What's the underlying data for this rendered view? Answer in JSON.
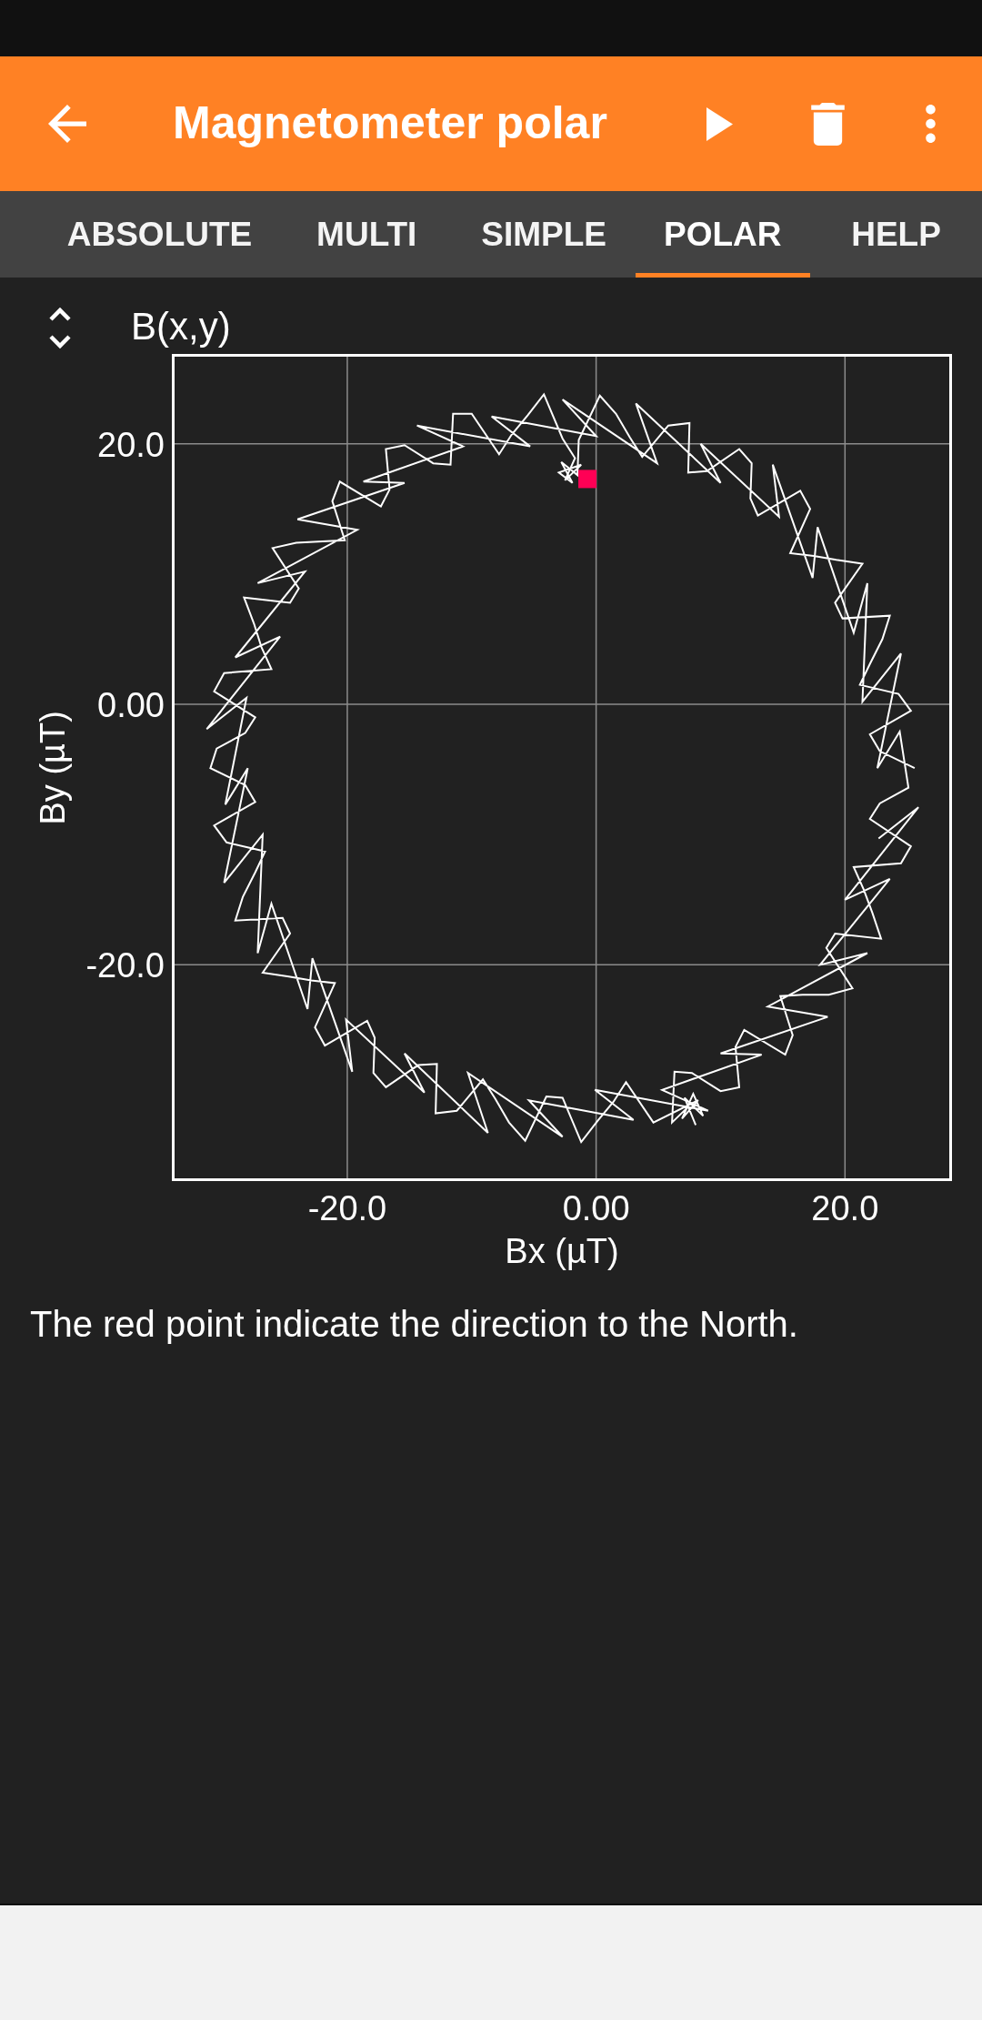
{
  "app_bar": {
    "title": "Magnetometer polar"
  },
  "tabs": [
    {
      "label": "ABSOLUTE",
      "selected": false
    },
    {
      "label": "MULTI",
      "selected": false
    },
    {
      "label": "SIMPLE",
      "selected": false
    },
    {
      "label": "POLAR",
      "selected": true
    },
    {
      "label": "HELP",
      "selected": false
    }
  ],
  "chart": {
    "chart_data": {
      "type": "line",
      "title": "B(x,y)",
      "xlabel": "Bx (µT)",
      "ylabel": "By (µT)",
      "grid": true,
      "x": [
        25.6,
        22.8,
        22.0,
        25.3,
        24.3,
        21.2,
        22.0,
        23.0,
        23.6,
        19.8,
        19.2,
        21.4,
        19.3,
        17.5,
        15.6,
        17.2,
        16.4,
        13.0,
        12.4,
        12.5,
        11.5,
        8.9,
        7.4,
        7.5,
        5.8,
        3.7,
        2.7,
        1.6,
        0.3,
        -1.4,
        -1.5,
        -2.8,
        -1.9,
        -3.0,
        -1.2,
        -2.5,
        -1.7,
        -2.7,
        -4.2,
        -5.5,
        -6.8,
        -7.8,
        -10.0,
        -11.5,
        -11.7,
        -13.1,
        -15.4,
        -16.9,
        -16.6,
        -17.3,
        -20.6,
        -21.2,
        -20.2,
        -22.0,
        -24.1,
        -26.0,
        -23.9,
        -24.6,
        -28.3,
        -27.5,
        -26.9,
        -26.1,
        -29.9,
        -30.7,
        -27.4,
        -28.2,
        -30.5,
        -31.0,
        -28.2,
        -27.4,
        -30.7,
        -29.7,
        -26.6,
        -27.4,
        -28.4,
        -29.0,
        -25.2,
        -24.6,
        -26.8,
        -24.7,
        -22.9,
        -21.0,
        -22.6,
        -21.8,
        -18.4,
        -17.8,
        -17.9,
        -16.9,
        -14.3,
        -12.8,
        -12.9,
        -11.2,
        -9.1,
        -8.1,
        -7.0,
        -5.7,
        -4.0,
        -2.7,
        -1.2,
        0.1,
        1.4,
        2.4,
        4.6,
        8.2,
        6.9,
        7.8,
        8.6,
        7.1,
        8.0,
        7.4,
        6.1,
        6.3,
        7.7,
        10.0,
        11.5,
        11.2,
        11.9,
        15.2,
        15.8,
        14.8,
        16.6,
        18.7,
        20.6,
        18.5,
        19.2,
        22.9,
        22.2,
        21.5,
        20.7,
        24.5,
        25.3,
        22.0,
        22.8,
        25.1,
        24.4,
        22.6,
        24.5,
        21.4,
        21.8,
        20.7,
        17.8,
        17.4,
        14.2,
        14.7,
        8.4,
        10.0,
        3.2,
        4.9,
        -2.7,
        0.0,
        -8.4,
        -5.3,
        -14.4,
        -10.7,
        -18.7,
        -15.4,
        -24.0,
        -19.2,
        -27.2,
        -23.4,
        -29.0,
        -25.4,
        -31.3,
        -28.1,
        -29.8,
        -28.0,
        -29.9,
        -26.8,
        -27.2,
        -26.1,
        -23.2,
        -22.8,
        -19.6,
        -20.1,
        -13.8,
        -15.4,
        -8.7,
        -10.3,
        -2.7,
        -5.4,
        3.0,
        -0.1,
        9.0,
        5.3,
        13.3,
        10.0,
        18.6,
        13.8,
        21.8,
        18.0,
        23.6,
        20.0,
        25.9,
        22.7,
        -0.7
      ],
      "series": [
        {
          "color": "#ffffff",
          "values": [
            -4.9,
            -3.6,
            -2.3,
            -0.5,
            0.8,
            1.5,
            3.1,
            5.0,
            6.8,
            6.6,
            7.8,
            10.8,
            11.1,
            11.4,
            11.6,
            15.0,
            16.4,
            14.5,
            15.8,
            18.5,
            19.6,
            17.9,
            17.8,
            21.6,
            21.4,
            19.0,
            20.5,
            22.3,
            23.7,
            20.3,
            17.6,
            18.6,
            17.0,
            17.8,
            18.4,
            17.2,
            18.9,
            20.4,
            23.8,
            22.2,
            20.7,
            19.2,
            22.3,
            22.3,
            18.4,
            18.5,
            19.9,
            19.6,
            16.5,
            15.2,
            17.1,
            15.6,
            12.6,
            12.5,
            12.4,
            12.0,
            8.9,
            7.8,
            8.2,
            6.2,
            4.4,
            2.7,
            2.4,
            1.0,
            -1.0,
            -2.2,
            -3.4,
            -4.9,
            -6.2,
            -7.5,
            -9.3,
            -10.6,
            -11.3,
            -12.9,
            -14.8,
            -16.6,
            -16.4,
            -17.6,
            -20.6,
            -20.9,
            -21.2,
            -21.4,
            -24.8,
            -26.2,
            -24.3,
            -25.6,
            -28.3,
            -29.4,
            -27.7,
            -27.6,
            -31.4,
            -31.2,
            -28.8,
            -30.3,
            -32.1,
            -33.5,
            -30.1,
            -30.2,
            -33.6,
            -32.0,
            -30.5,
            -29.0,
            -32.1,
            -30.4,
            -31.8,
            -29.9,
            -31.6,
            -30.2,
            -32.3,
            -30.9,
            -32.1,
            -28.2,
            -28.3,
            -29.7,
            -29.4,
            -26.3,
            -25.0,
            -26.9,
            -25.4,
            -22.4,
            -22.3,
            -22.3,
            -21.8,
            -18.7,
            -17.6,
            -18.0,
            -16.0,
            -14.2,
            -12.5,
            -12.2,
            -10.9,
            -8.8,
            -7.6,
            -6.4,
            -2.1,
            -4.9,
            3.9,
            0.2,
            9.3,
            5.5,
            13.6,
            9.7,
            18.4,
            14.4,
            20.0,
            17.0,
            23.1,
            18.5,
            23.4,
            20.6,
            22.1,
            19.8,
            21.4,
            19.8,
            17.1,
            17.0,
            14.2,
            13.4,
            9.3,
            10.2,
            3.6,
            5.2,
            -1.9,
            0.5,
            -7.7,
            -4.9,
            -13.7,
            -10.0,
            -19.1,
            -15.3,
            -23.4,
            -19.5,
            -28.2,
            -24.2,
            -29.8,
            -26.8,
            -32.9,
            -28.3,
            -33.2,
            -30.4,
            -31.9,
            -29.6,
            -31.2,
            -29.6,
            -26.9,
            -26.8,
            -24.0,
            -23.2,
            -19.1,
            -20.0,
            -13.4,
            -15.0,
            -7.9,
            -10.3,
            null
          ]
        },
        {
          "color": "#ff0055",
          "marker": "square",
          "values": [
            null,
            null,
            null,
            null,
            null,
            null,
            null,
            null,
            null,
            null,
            null,
            null,
            null,
            null,
            null,
            null,
            null,
            null,
            null,
            null,
            null,
            null,
            null,
            null,
            null,
            null,
            null,
            null,
            null,
            null,
            null,
            null,
            null,
            null,
            null,
            null,
            null,
            null,
            null,
            null,
            null,
            null,
            null,
            null,
            null,
            null,
            null,
            null,
            null,
            null,
            null,
            null,
            null,
            null,
            null,
            null,
            null,
            null,
            null,
            null,
            null,
            null,
            null,
            null,
            null,
            null,
            null,
            null,
            null,
            null,
            null,
            null,
            null,
            null,
            null,
            null,
            null,
            null,
            null,
            null,
            null,
            null,
            null,
            null,
            null,
            null,
            null,
            null,
            null,
            null,
            null,
            null,
            null,
            null,
            null,
            null,
            null,
            null,
            null,
            null,
            null,
            null,
            null,
            null,
            null,
            null,
            null,
            null,
            null,
            null,
            null,
            null,
            null,
            null,
            null,
            null,
            null,
            null,
            null,
            null,
            null,
            null,
            null,
            null,
            null,
            null,
            null,
            null,
            null,
            null,
            null,
            null,
            null,
            null,
            null,
            null,
            null,
            null,
            null,
            null,
            null,
            null,
            null,
            null,
            null,
            null,
            null,
            null,
            null,
            null,
            null,
            null,
            null,
            null,
            null,
            null,
            null,
            null,
            null,
            null,
            null,
            null,
            null,
            null,
            null,
            null,
            null,
            null,
            null,
            null,
            null,
            null,
            null,
            null,
            null,
            null,
            null,
            null,
            null,
            null,
            null,
            null,
            null,
            null,
            null,
            null,
            null,
            null,
            null,
            null,
            null,
            null,
            null,
            null,
            17.3
          ]
        }
      ],
      "xlim": [
        -34.1,
        28.6
      ],
      "ylim": [
        -36.6,
        26.9
      ],
      "xticks": [
        {
          "value": -20,
          "label": "-20.0"
        },
        {
          "value": 0,
          "label": "0.00"
        },
        {
          "value": 20,
          "label": "20.0"
        }
      ],
      "yticks": [
        {
          "value": 20,
          "label": "20.0"
        },
        {
          "value": 0,
          "label": "0.00"
        },
        {
          "value": -20,
          "label": "-20.0"
        }
      ]
    }
  },
  "caption": "The red point indicate the direction to the North."
}
